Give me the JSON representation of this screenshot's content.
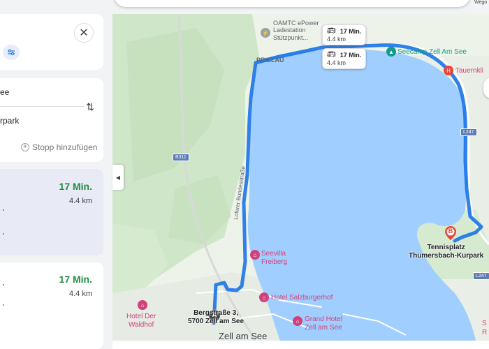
{
  "panel": {
    "close_icon": "close-icon",
    "options_icon": "tune-icon",
    "origin_partial": "ee",
    "destination_partial": "rpark",
    "swap_icon": "swap-vertical-icon",
    "add_stop_label": "Stopp hinzufügen",
    "routes": [
      {
        "time": "17 Min.",
        "distance": "4.4 km",
        "selected": true
      },
      {
        "time": "17 Min.",
        "distance": "4.4 km",
        "selected": false
      }
    ]
  },
  "top_right_partial": "Wego",
  "map": {
    "bubbles": [
      {
        "time": "17 Min.",
        "distance": "4.4 km",
        "icon": "bus-icon"
      },
      {
        "time": "17 Min.",
        "distance": "4.4 km",
        "icon": "bus-icon"
      }
    ],
    "labels": {
      "oamtc": "OAMTC ePower\nLadestation\nStützpunkt...",
      "prielau": "PRIELAU",
      "seecamp": "Seecamp Zell Am See",
      "tauern": "Tauernkli",
      "b311": "B311",
      "l247_top": "L247",
      "l247_bottom": "L247",
      "lofererstrasse": "Loferer Bundesstraße",
      "seevilla": "Seevilla\nFreiberg",
      "salzburgerhof": "Hotel Salzburgerhof",
      "grand_hotel": "Grand Hotel\nZell am See",
      "waldhof": "Hotel Der\nWaldhof",
      "origin": "Bergstraße 3,\n5700 Zell am See",
      "destination": "Tennisplatz\nThumersbach-Kurpark",
      "town": "Zell am See",
      "edge_s": "S",
      "edge_r": "R"
    },
    "markers": {
      "origin": "A",
      "destination": "B"
    },
    "colors": {
      "water": "#a0cfff",
      "route": "#4285f4",
      "forest": "#cfe6c8",
      "land": "#eef3ea"
    }
  }
}
